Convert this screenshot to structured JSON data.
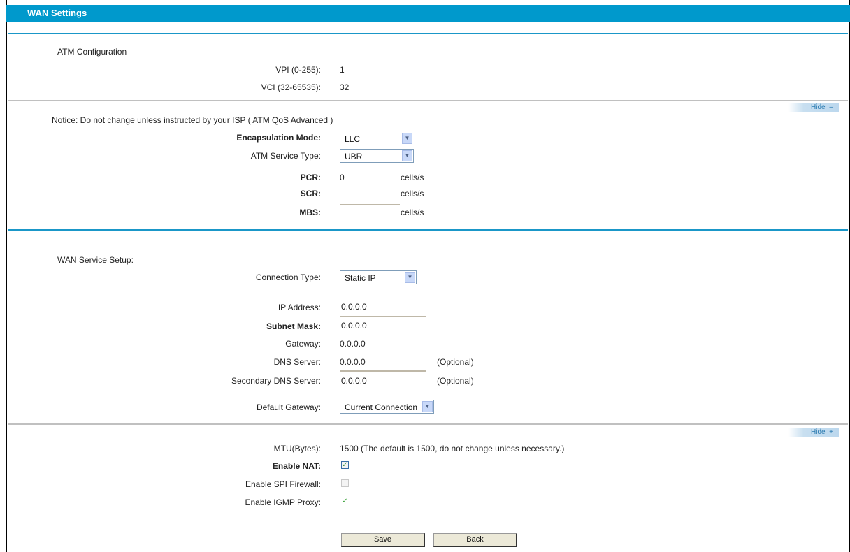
{
  "header": {
    "title": "WAN Settings"
  },
  "atm": {
    "section_title": "ATM Configuration",
    "vpi_label": "VPI (0-255):",
    "vpi_value": "1",
    "vci_label": "VCI (32-65535):",
    "vci_value": "32"
  },
  "advanced_toggle_1": {
    "label": "Hide",
    "symbol": "–"
  },
  "qos": {
    "section_title": "Notice: Do not change unless instructed by your ISP ( ATM QoS Advanced )",
    "encap_label": "Encapsulation Mode:",
    "encap_value": "LLC",
    "service_type_label": "ATM Service Type:",
    "service_type_value": "UBR",
    "pcr_label": "PCR:",
    "pcr_value": "0",
    "pcr_hint": "cells/s",
    "scr_label": "SCR:",
    "scr_hint": "cells/s",
    "mbs_label": "MBS:",
    "mbs_hint": "cells/s"
  },
  "wan_service": {
    "section_title": "WAN Service Setup:",
    "connection_type_label": "Connection Type:",
    "connection_type_value": "Static IP",
    "ip_label": "IP Address:",
    "ip_value": "0.0.0.0",
    "subnet_label": "Subnet Mask:",
    "subnet_value": "0.0.0.0",
    "gateway_label": "Gateway:",
    "gateway_value": "0.0.0.0",
    "dns_label": "DNS Server:",
    "dns_value": "0.0.0.0",
    "dns_hint": "(Optional)",
    "sec_dns_label": "Secondary DNS Server:",
    "sec_dns_value": "0.0.0.0",
    "sec_dns_hint": "(Optional)",
    "default_gw_label": "Default Gateway:",
    "default_gw_value": "Current Connection"
  },
  "advanced_toggle_2": {
    "label": "Hide",
    "symbol": "+"
  },
  "advanced": {
    "mtu_label": "MTU(Bytes):",
    "mtu_value": "1500 (The default is 1500, do not change unless necessary.)",
    "nat_label": "Enable NAT:",
    "firewall_label": "Enable SPI Firewall:",
    "igmp_label": "Enable IGMP Proxy:"
  },
  "buttons": {
    "save": "Save",
    "back": "Back"
  },
  "colors": {
    "title_bar": "#0099cc",
    "rule_blue": "#1a97c8",
    "rule_gray": "#c0c0c0"
  }
}
